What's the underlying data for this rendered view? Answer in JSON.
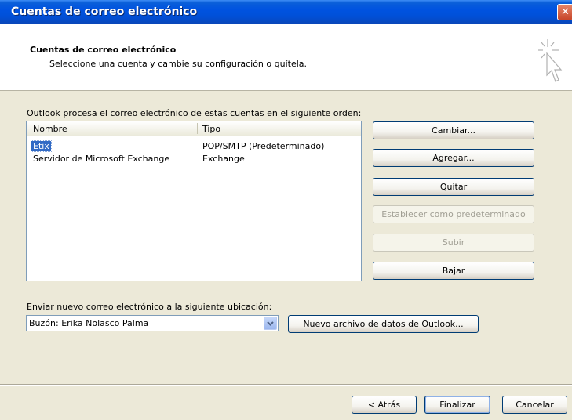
{
  "window": {
    "title": "Cuentas de correo electrónico",
    "close_glyph": "✕"
  },
  "header": {
    "title": "Cuentas de correo electrónico",
    "subtitle": "Seleccione una cuenta y cambie su configuración o quítela."
  },
  "accounts": {
    "intro": "Outlook procesa el correo electrónico de estas cuentas en el siguiente orden:",
    "columns": [
      "Nombre",
      "Tipo"
    ],
    "rows": [
      {
        "name": "Etix",
        "type": "POP/SMTP (Predeterminado)",
        "selected": true
      },
      {
        "name": "Servidor de Microsoft Exchange",
        "type": "Exchange",
        "selected": false
      }
    ]
  },
  "actions": {
    "change": "Cambiar...",
    "add": "Agregar...",
    "remove": "Quitar",
    "set_default": "Establecer como predeterminado",
    "up": "Subir",
    "down": "Bajar"
  },
  "delivery": {
    "label": "Enviar nuevo correo electrónico a la siguiente ubicación:",
    "selected": "Buzón: Erika Nolasco Palma",
    "new_datafile": "Nuevo archivo de datos de Outlook..."
  },
  "footer": {
    "back": "< Atrás",
    "finish": "Finalizar",
    "cancel": "Cancelar"
  },
  "colors": {
    "title_bar": "#0053e0",
    "selection": "#316ac5",
    "face": "#ece9d8"
  }
}
